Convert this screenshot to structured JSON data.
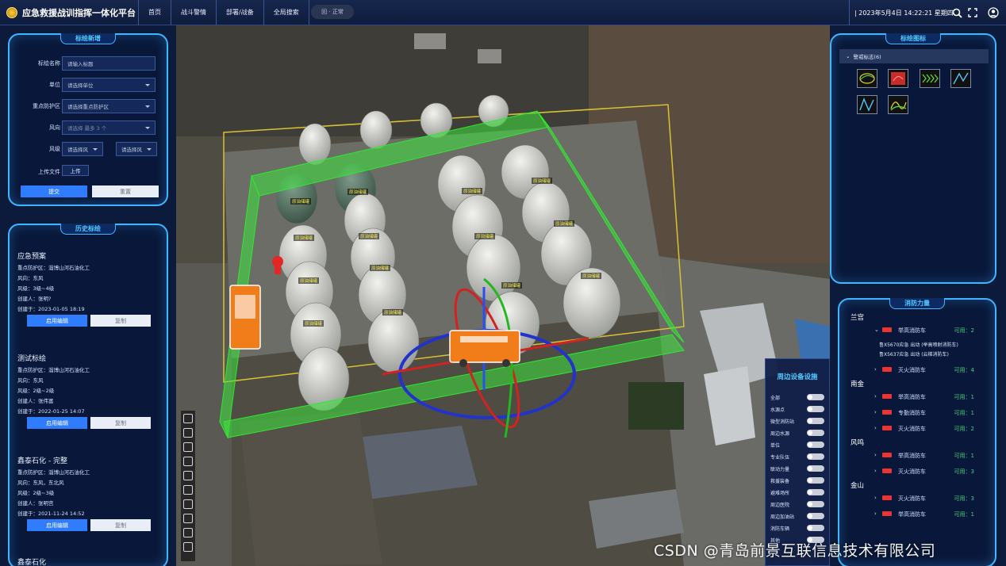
{
  "header": {
    "app_title": "应急救援战训指挥一体化平台",
    "nav": [
      "首页",
      "战斗警情",
      "部署/战备",
      "全局搜索"
    ],
    "datetime": "| 2023年5月4日 14:22:21 星期四",
    "search_icon": "search-icon",
    "fullscreen_icon": "fullscreen-icon",
    "user_icon": "user-icon"
  },
  "plot_form": {
    "title": "标绘新增",
    "name_label": "标绘名称",
    "name_placeholder": "请输入标题",
    "unit_label": "单位",
    "unit_placeholder": "请选择单位",
    "area_label": "重点防护区",
    "area_placeholder": "请选择重点防护区",
    "wind_dir_label": "风向",
    "wind_dir_placeholder": "请选择 最多 3 个",
    "wind_level_label": "风级",
    "wind_level_from": "请选择风",
    "wind_level_to": "请选择风",
    "upload_label": "上传文件",
    "upload_button": "上传",
    "submit": "提交",
    "reset": "重置"
  },
  "history": {
    "title": "历史标绘",
    "cards": [
      {
        "title": "应急预案",
        "area": "重点防护区：淄博山河石油化工",
        "wind_dir": "风向：东风",
        "wind_level": "风级：3级~4级",
        "creator": "创建人：张明?",
        "created": "创建于：2023-01-05 18:19",
        "edit": "启用编辑",
        "copy": "复制"
      },
      {
        "title": "测试标绘",
        "area": "重点防护区：淄博山河石油化工",
        "wind_dir": "风向：东风",
        "wind_level": "风级：2级~2级",
        "creator": "创建人：张伟富",
        "created": "创建于：2022-01-25 14:07",
        "edit": "启用编辑",
        "copy": "复制"
      },
      {
        "title": "鑫泰石化 - 完整",
        "area": "重点防护区：淄博山河石油化工",
        "wind_dir": "风向：东风，东北风",
        "wind_level": "风级：2级~3级",
        "creator": "创建人：张明宫",
        "created": "创建于：2021-11-24 14:52",
        "edit": "启用编辑",
        "copy": "复制"
      },
      {
        "title": "鑫泰石化"
      }
    ]
  },
  "map": {
    "tank_label": "原油储罐",
    "pill_label": "回 · 正常"
  },
  "plot_icons": {
    "title": "标绘图标",
    "group": "警戒标志(6)",
    "icons": [
      "area-outline-icon",
      "fire-zone-icon",
      "arrow-chevrons-icon",
      "line-v-icon",
      "line-wave-icon",
      "curve-icon"
    ]
  },
  "fire_force": {
    "title": "消防力量",
    "groups": [
      {
        "town": "兰宫",
        "units": [
          {
            "name": "举高消防车",
            "avail": "可用：2",
            "subs": [
              "鲁X5670应急 出动 (举高喷射消防车)",
              "鲁X5637应急 出动 (云梯消防车)"
            ]
          },
          {
            "name": "灭火消防车",
            "avail": "可用：4",
            "subs": []
          }
        ]
      },
      {
        "town": "南金",
        "units": [
          {
            "name": "举高消防车",
            "avail": "可用：1",
            "subs": []
          },
          {
            "name": "专勤消防车",
            "avail": "可用：1",
            "subs": []
          },
          {
            "name": "灭火消防车",
            "avail": "可用：2",
            "subs": []
          }
        ]
      },
      {
        "town": "风鸣",
        "units": [
          {
            "name": "举高消防车",
            "avail": "可用：1",
            "subs": []
          },
          {
            "name": "灭火消防车",
            "avail": "可用：3",
            "subs": []
          }
        ]
      },
      {
        "town": "金山",
        "units": [
          {
            "name": "灭火消防车",
            "avail": "可用：3",
            "subs": []
          },
          {
            "name": "举高消防车",
            "avail": "可用：1",
            "subs": []
          }
        ]
      }
    ]
  },
  "facilities": {
    "title": "周边设备设施",
    "items": [
      "全部",
      "水源点",
      "微型消防站",
      "周边水源",
      "单位",
      "专业队伍",
      "联动力量",
      "救援装备",
      "避难场所",
      "周边医院",
      "周边加油站",
      "消防车辆",
      "其他"
    ]
  },
  "watermark": "CSDN @青岛前景互联信息技术有限公司"
}
